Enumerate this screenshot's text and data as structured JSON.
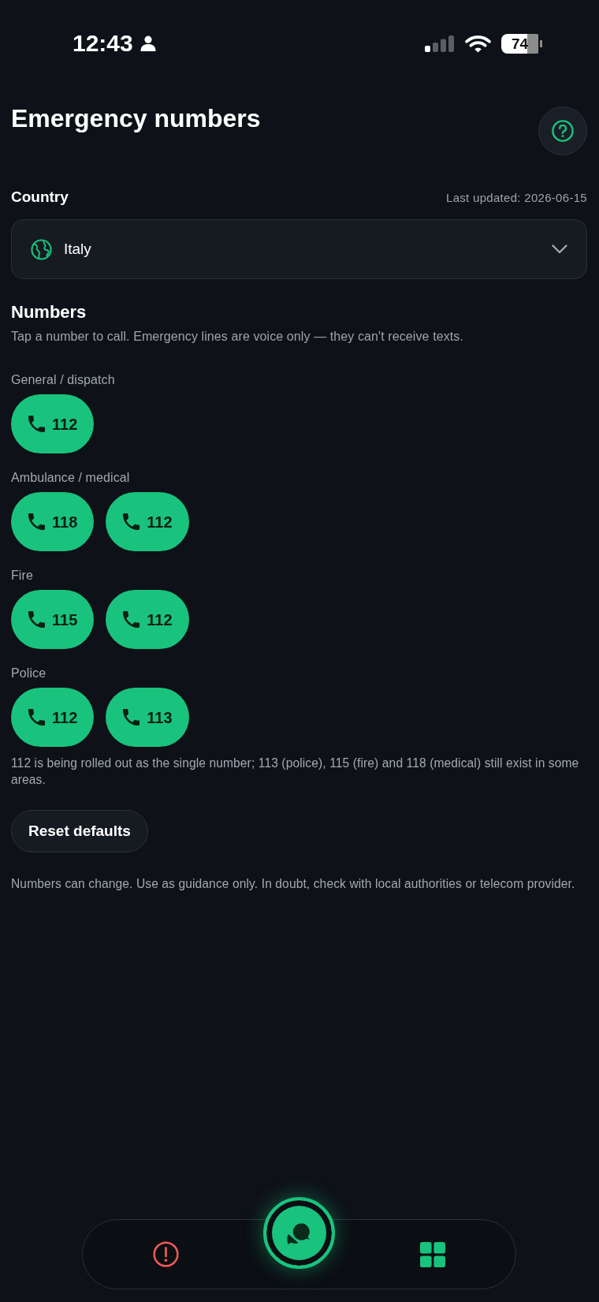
{
  "status_bar": {
    "time": "12:43",
    "battery": "74"
  },
  "header": {
    "title": "Emergency numbers"
  },
  "country": {
    "label": "Country",
    "last_updated": "Last updated: 2026-06-15",
    "value": "Italy"
  },
  "numbers": {
    "heading": "Numbers",
    "description": "Tap a number to call. Emergency lines are voice only — they can't receive texts.",
    "groups": [
      {
        "label": "General / dispatch",
        "numbers": [
          "112"
        ]
      },
      {
        "label": "Ambulance / medical",
        "numbers": [
          "118",
          "112"
        ]
      },
      {
        "label": "Fire",
        "numbers": [
          "115",
          "112"
        ]
      },
      {
        "label": "Police",
        "numbers": [
          "112",
          "113"
        ]
      }
    ],
    "note": "112 is being rolled out as the single number; 113 (police), 115 (fire) and 118 (medical) still exist in some areas."
  },
  "reset_button": "Reset defaults",
  "disclaimer": "Numbers can change. Use as guidance only. In doubt, check with local authorities or telecom provider."
}
